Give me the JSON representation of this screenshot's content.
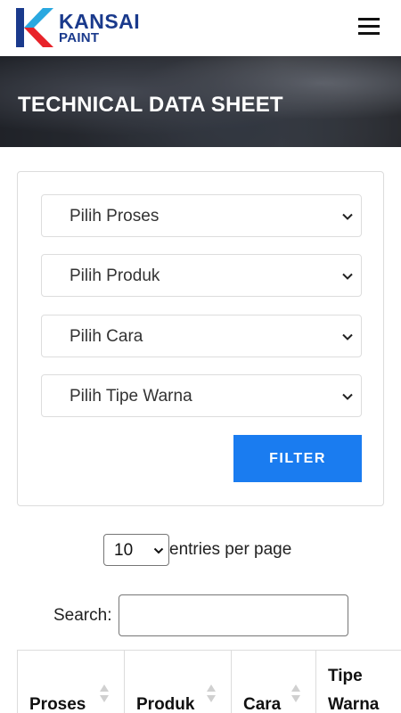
{
  "header": {
    "brand_line1": "KANSAI",
    "brand_line2": "PAINT",
    "menu_icon": "hamburger-menu-icon"
  },
  "banner": {
    "title": "TECHNICAL DATA SHEET"
  },
  "filters": {
    "selects": [
      {
        "label": "Pilih Proses"
      },
      {
        "label": "Pilih Produk"
      },
      {
        "label": "Pilih Cara"
      },
      {
        "label": "Pilih Tipe Warna"
      }
    ],
    "button_label": "FILTER"
  },
  "entries": {
    "value": "10",
    "label": "entries per page"
  },
  "search": {
    "label": "Search:",
    "value": ""
  },
  "table": {
    "columns": [
      "Proses",
      "Produk",
      "Cara",
      "Tipe\nWarna"
    ],
    "column_lines": [
      [
        "Proses"
      ],
      [
        "Produk"
      ],
      [
        "Cara"
      ],
      [
        "Tipe",
        "Warna"
      ]
    ]
  },
  "colors": {
    "brand_blue": "#1a3a8c",
    "brand_red": "#e8232a",
    "brand_light_blue": "#2aa8e0",
    "filter_button": "#1a7cf0"
  }
}
